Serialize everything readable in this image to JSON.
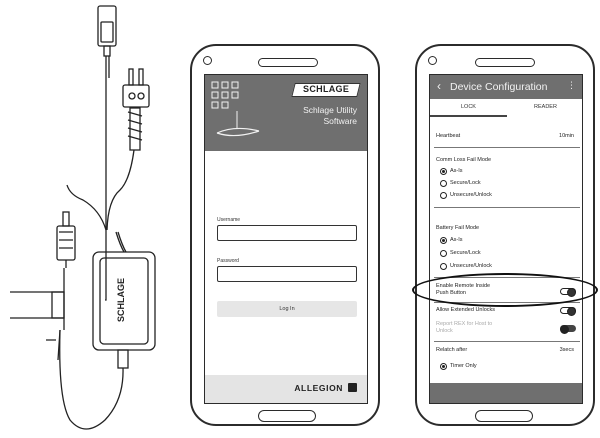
{
  "device_label": "SCHLAGE",
  "login_screen": {
    "brand_logo": "SCHLAGE",
    "app_title_line1": "Schlage Utility",
    "app_title_line2": "Software",
    "username_label": "Username",
    "password_label": "Password",
    "login_button": "Log In",
    "footer_logo": "ALLEGION"
  },
  "config_screen": {
    "title": "Device Configuration",
    "tabs": [
      "LOCK",
      "READER"
    ],
    "active_tab": "LOCK",
    "heartbeat": {
      "label": "Heartbeat",
      "value": "10min"
    },
    "comm_loss": {
      "label": "Comm Loss Fail Mode",
      "options": [
        "As-Is",
        "Secure/Lock",
        "Unsecure/Unlock"
      ],
      "selected": "As-Is"
    },
    "battery_fail": {
      "label": "Battery Fail Mode",
      "options": [
        "As-Is",
        "Secure/Lock",
        "Unsecure/Unlock"
      ],
      "selected": "As-Is"
    },
    "toggles": [
      {
        "label_line1": "Enable Remote Inside",
        "label_line2": "Push Button",
        "on": false,
        "enabled": true
      },
      {
        "label_line1": "Allow Extended Unlocks",
        "label_line2": "",
        "on": false,
        "enabled": true
      },
      {
        "label_line1": "Report REX for Host to",
        "label_line2": "Unlock",
        "on": true,
        "enabled": false
      }
    ],
    "relatch": {
      "label": "Relatch after",
      "value": "3secs"
    },
    "relatch_mode": {
      "label": "Timer Only",
      "selected": true
    }
  },
  "colors": {
    "header_gray": "#6f6f6f",
    "outline": "#2b2b2b",
    "footer_light": "#e4e4e4"
  }
}
